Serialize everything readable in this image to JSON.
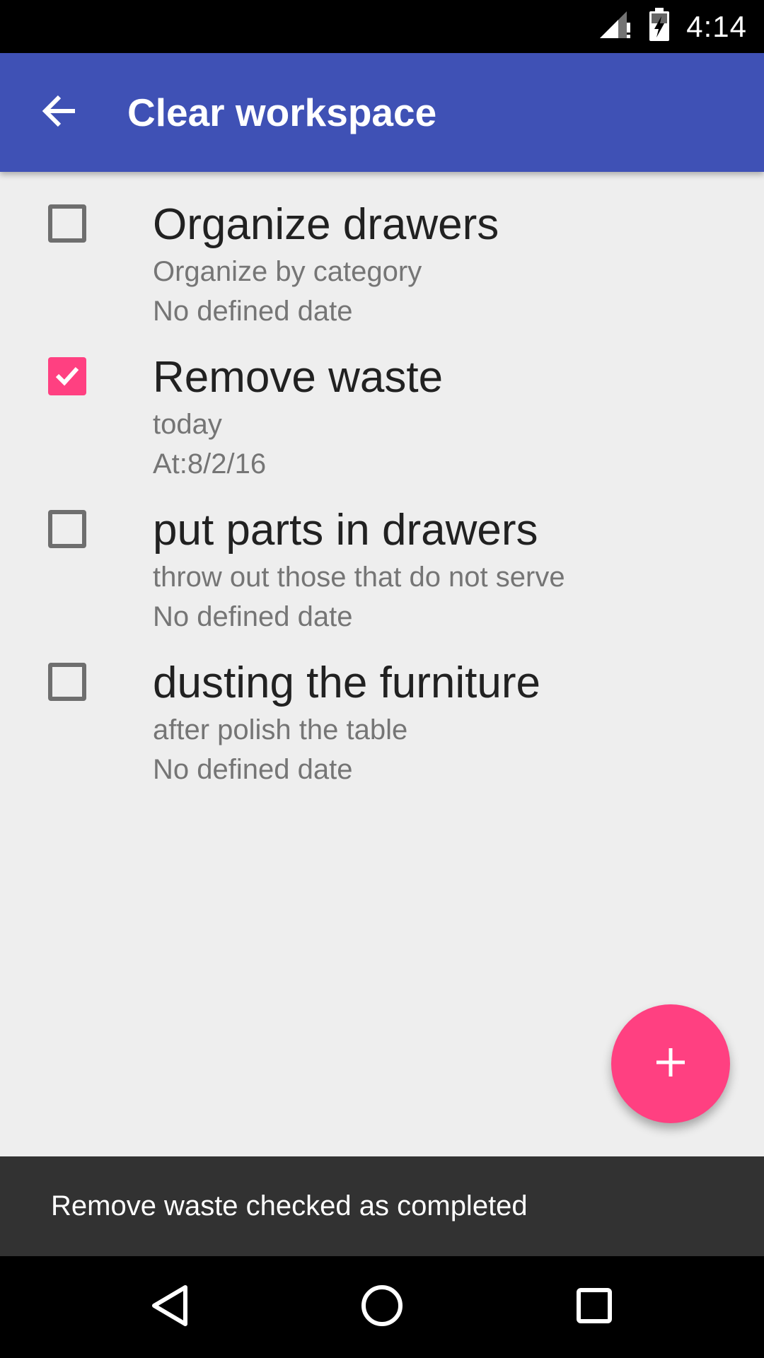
{
  "status_bar": {
    "time": "4:14",
    "icons": [
      "signal-no-data-icon",
      "battery-charging-icon"
    ]
  },
  "app_bar": {
    "title": "Clear workspace",
    "back_icon": "arrow-back-icon",
    "color": "#3f51b5"
  },
  "tasks": [
    {
      "title": "Organize drawers",
      "subtitle": "Organize by category",
      "date": "No defined date",
      "checked": false
    },
    {
      "title": "Remove waste",
      "subtitle": "today",
      "date": "At:8/2/16",
      "checked": true
    },
    {
      "title": "put parts in drawers",
      "subtitle": "throw out those that do not serve",
      "date": "No defined date",
      "checked": false
    },
    {
      "title": "dusting the furniture",
      "subtitle": "after polish the table",
      "date": "No defined date",
      "checked": false
    }
  ],
  "fab": {
    "icon": "plus-icon",
    "color": "#ff4081"
  },
  "snackbar": {
    "text": "Remove waste checked as completed"
  },
  "nav_bar": {
    "icons": [
      "back-triangle-icon",
      "home-circle-icon",
      "recents-square-icon"
    ]
  },
  "colors": {
    "accent": "#ff4081",
    "primary": "#3f51b5",
    "background": "#eeeeee"
  }
}
